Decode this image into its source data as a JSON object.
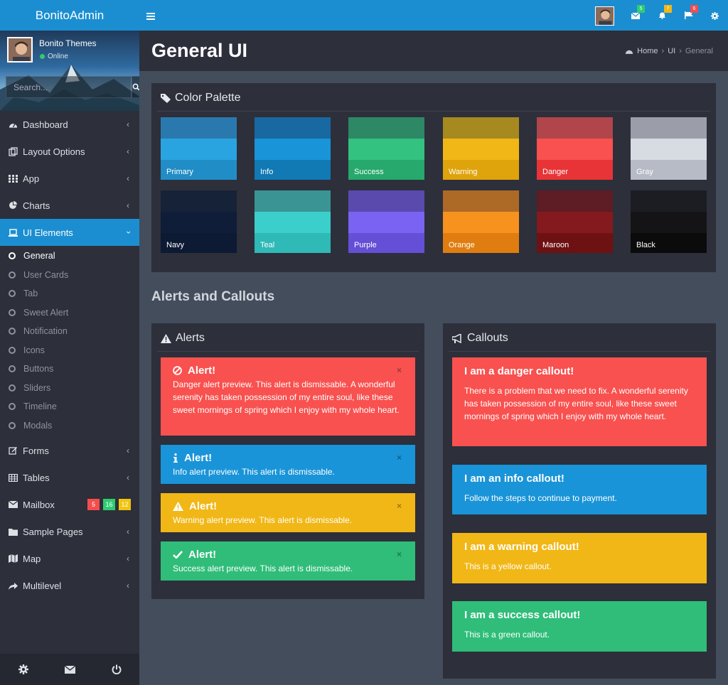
{
  "app": {
    "brand": "BonitoAdmin"
  },
  "user": {
    "name": "Bonito Themes",
    "status": "Online"
  },
  "search": {
    "placeholder": "Search..."
  },
  "sidebar": {
    "items": [
      {
        "label": "Dashboard",
        "icon": "dashboard-icon"
      },
      {
        "label": "Layout Options",
        "icon": "copy-icon"
      },
      {
        "label": "App",
        "icon": "grid-icon"
      },
      {
        "label": "Charts",
        "icon": "pie-chart-icon"
      },
      {
        "label": "UI Elements",
        "icon": "laptop-icon"
      }
    ],
    "sub_items": [
      "General",
      "User Cards",
      "Tab",
      "Sweet Alert",
      "Notification",
      "Icons",
      "Buttons",
      "Sliders",
      "Timeline",
      "Modals"
    ],
    "items_after": [
      {
        "label": "Forms",
        "icon": "edit-icon"
      },
      {
        "label": "Tables",
        "icon": "table-icon"
      },
      {
        "label": "Mailbox",
        "icon": "envelope-icon"
      },
      {
        "label": "Sample Pages",
        "icon": "folder-icon"
      },
      {
        "label": "Map",
        "icon": "map-icon"
      },
      {
        "label": "Multilevel",
        "icon": "share-icon"
      }
    ],
    "mailbox_badges": [
      {
        "value": "5",
        "color": "#f44d4d"
      },
      {
        "value": "16",
        "color": "#2ecc71"
      },
      {
        "value": "12",
        "color": "#f1c40f"
      }
    ]
  },
  "topbar": {
    "messages_count": "5",
    "notifications_count": "7",
    "tasks_count": "6"
  },
  "page": {
    "title": "General UI",
    "breadcrumb": {
      "home": "Home",
      "level1": "UI",
      "current": "General"
    }
  },
  "palette": {
    "title": "Color Palette",
    "swatches": [
      {
        "label": "Primary",
        "colors": [
          "#2a79ae",
          "#2aa4e0",
          "#218dc6"
        ]
      },
      {
        "label": "Info",
        "colors": [
          "#1868a1",
          "#1a94d8",
          "#1179b4"
        ]
      },
      {
        "label": "Success",
        "colors": [
          "#2d8865",
          "#33c27f",
          "#27a86c"
        ]
      },
      {
        "label": "Warning",
        "colors": [
          "#a6891f",
          "#f1b716",
          "#dfa30b"
        ]
      },
      {
        "label": "Danger",
        "colors": [
          "#b0454b",
          "#f8514f",
          "#e83436"
        ]
      },
      {
        "label": "Gray",
        "colors": [
          "#9b9ea8",
          "#d7dbe2",
          "#b6bbc6"
        ]
      },
      {
        "label": "Navy",
        "colors": [
          "#162238",
          "#0f1d38",
          "#0c1a33"
        ]
      },
      {
        "label": "Teal",
        "colors": [
          "#3a9493",
          "#3bcfcc",
          "#2fb9b7"
        ]
      },
      {
        "label": "Purple",
        "colors": [
          "#5a4aae",
          "#7a63f2",
          "#644fd6"
        ]
      },
      {
        "label": "Orange",
        "colors": [
          "#ad6a27",
          "#f7921e",
          "#e07d10"
        ]
      },
      {
        "label": "Maroon",
        "colors": [
          "#5e1c25",
          "#841a1d",
          "#6d1113"
        ]
      },
      {
        "label": "Black",
        "colors": [
          "#1c1d22",
          "#141416",
          "#0b0b0c"
        ]
      }
    ]
  },
  "section": {
    "title": "Alerts and Callouts"
  },
  "alerts": {
    "title": "Alerts",
    "items": [
      {
        "title": "Alert!",
        "text": "Danger alert preview. This alert is dismissable. A wonderful serenity has taken possession of my entire soul, like these sweet mornings of spring which I enjoy with my whole heart.",
        "color": "#f8514f",
        "icon": "ban-icon"
      },
      {
        "title": "Alert!",
        "text": "Info alert preview. This alert is dismissable.",
        "color": "#1a94d8",
        "icon": "info-icon"
      },
      {
        "title": "Alert!",
        "text": "Warning alert preview. This alert is dismissable.",
        "color": "#f1b716",
        "icon": "warning-icon"
      },
      {
        "title": "Alert!",
        "text": "Success alert preview. This alert is dismissable.",
        "color": "#2fbd79",
        "icon": "check-icon"
      }
    ],
    "close_symbol": "×"
  },
  "callouts": {
    "title": "Callouts",
    "items": [
      {
        "title": "I am a danger callout!",
        "text": "There is a problem that we need to fix. A wonderful serenity has taken possession of my entire soul, like these sweet mornings of spring which I enjoy with my whole heart.",
        "color": "#f8514f"
      },
      {
        "title": "I am an info callout!",
        "text": "Follow the steps to continue to payment.",
        "color": "#1a94d8"
      },
      {
        "title": "I am a warning callout!",
        "text": "This is a yellow callout.",
        "color": "#f1b716"
      },
      {
        "title": "I am a success callout!",
        "text": "This is a green callout.",
        "color": "#2fbd79"
      }
    ]
  }
}
